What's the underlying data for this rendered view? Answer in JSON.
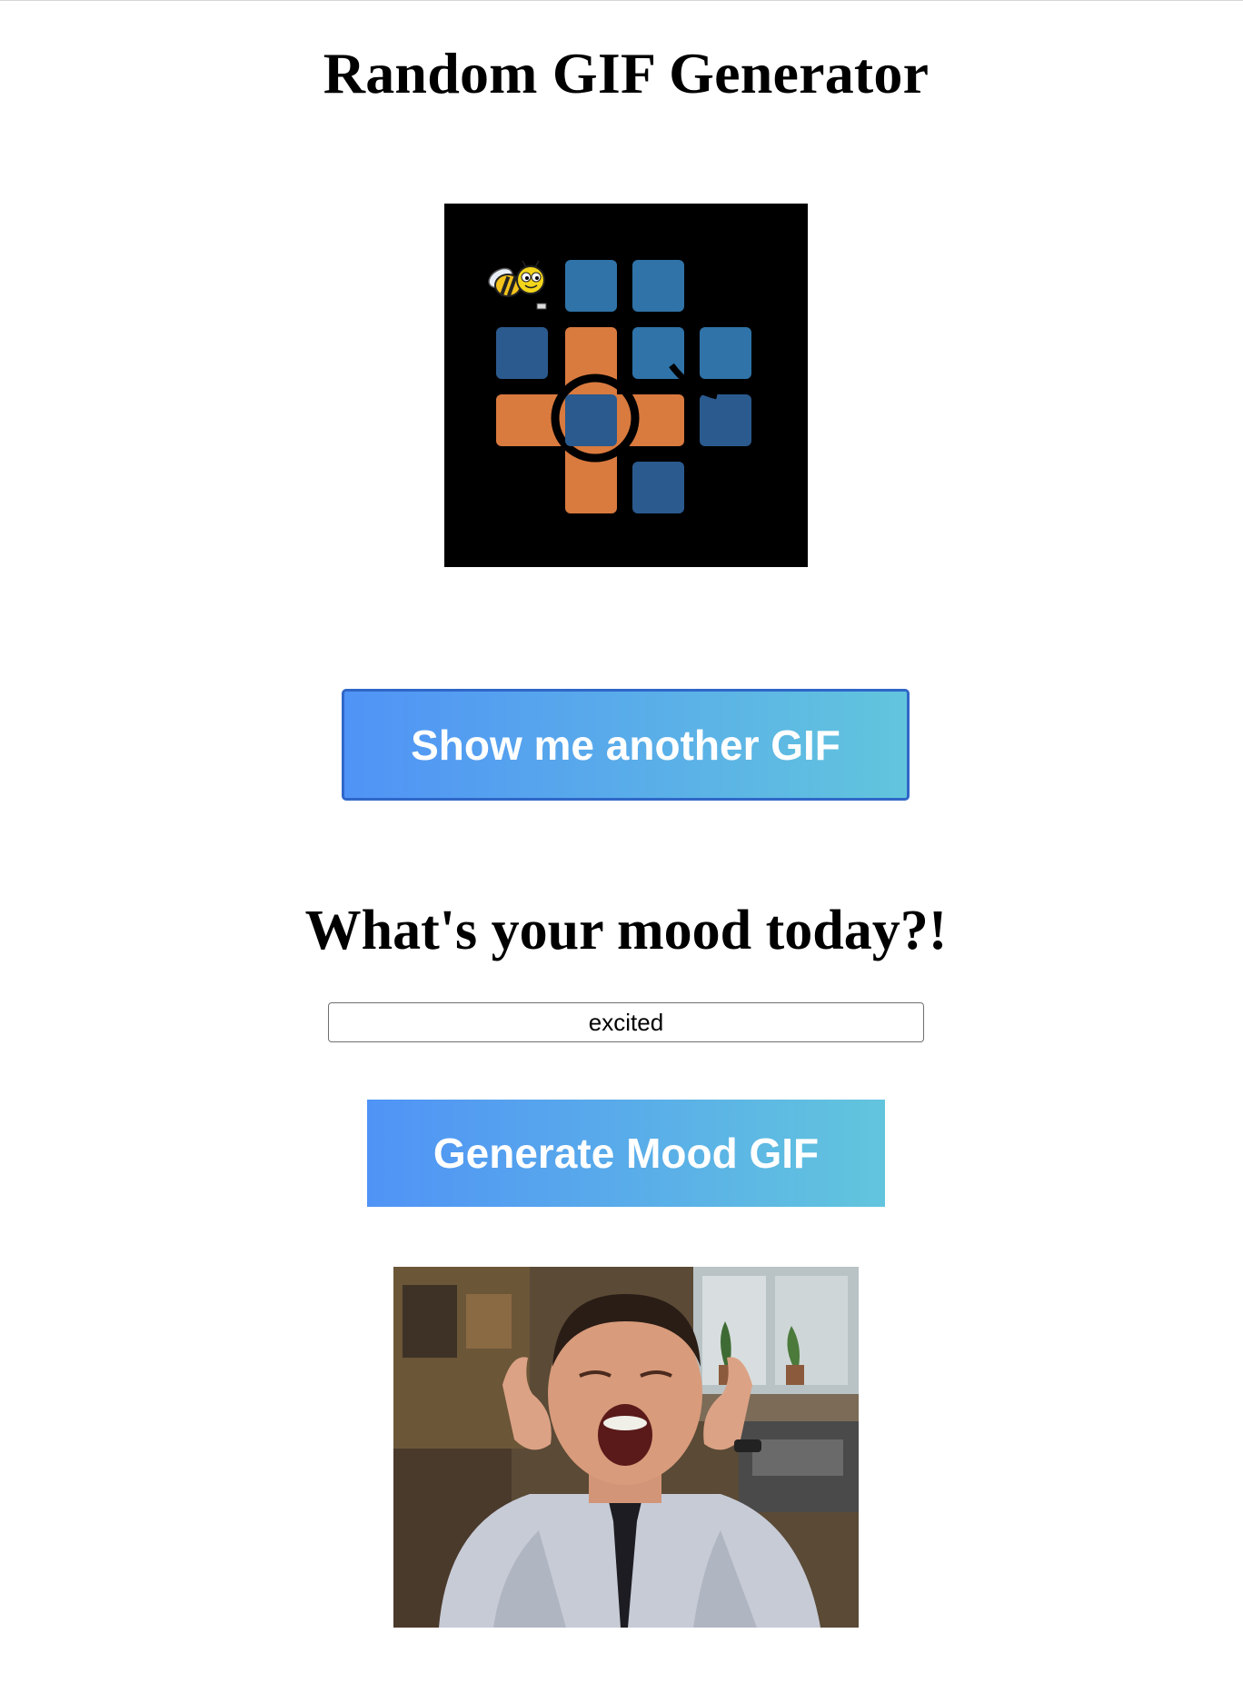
{
  "page": {
    "title": "Random GIF Generator"
  },
  "random_gif": {
    "icon": "bee-puzzle-grid-image"
  },
  "buttons": {
    "show_another_label": "Show me another GIF",
    "generate_mood_label": "Generate Mood GIF"
  },
  "mood": {
    "heading": "What's your mood today?!",
    "input_value": "excited"
  },
  "mood_gif": {
    "icon": "excited-man-screaming-photo"
  },
  "colors": {
    "button_gradient_start": "#5093f6",
    "button_gradient_end": "#62c5dd",
    "button_border": "#2f67c8",
    "tile_orange": "#d97a3f",
    "tile_blue": "#2f73a8",
    "tile_dark_blue": "#2b5a8e"
  }
}
